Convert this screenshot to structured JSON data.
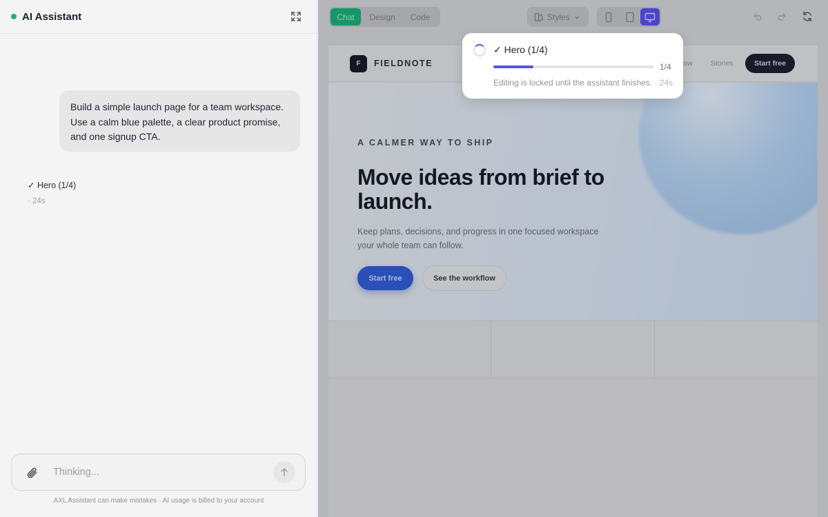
{
  "chat": {
    "title": "AI Assistant",
    "user_message": "Build a simple launch page for a team workspace. Use a calm blue palette, a clear product promise, and one signup CTA.",
    "step": {
      "label": "✓ Hero (1/4)",
      "time": "· 24s"
    },
    "composer": {
      "placeholder": "Thinking..."
    },
    "disclaimer": "AXL Assistant can make mistakes · AI usage is billed to your account"
  },
  "toolbar": {
    "tabs": [
      "Chat",
      "Design",
      "Code"
    ],
    "active_tab": "Chat",
    "styles_label": "Styles",
    "active_device": "desktop"
  },
  "progress": {
    "label": "✓ Hero (1/4)",
    "count": "1/4",
    "fraction": 0.25,
    "note": "Editing is locked until the assistant finishes.",
    "time": "· 24s"
  },
  "site": {
    "logo_letter": "F",
    "brand": "FIELDNOTE",
    "nav_links": [
      "flow",
      "Stories"
    ],
    "nav_cta": "Start free",
    "hero": {
      "kicker": "A CALMER WAY TO SHIP",
      "title": "Move ideas from brief to launch.",
      "body": "Keep plans, decisions, and progress in one focused workspace your whole team can follow.",
      "primary_cta": "Start free",
      "secondary_cta": "See the workflow"
    }
  },
  "colors": {
    "status_green": "#1fb27a",
    "active_tab": "#199668",
    "device_active": "#4b45c8",
    "progress": "#5a55d6",
    "hero_cta": "#2a4fb8"
  }
}
